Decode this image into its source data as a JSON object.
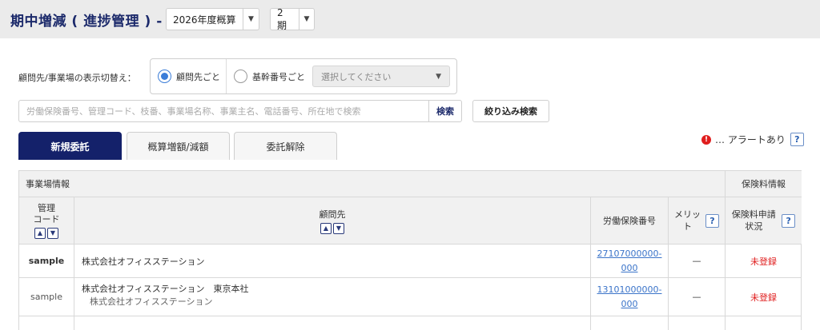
{
  "header": {
    "title": "期中増減 ( 進捗管理 ) -",
    "fiscal_select": "2026年度概算",
    "period_select": "2期"
  },
  "display_switch": {
    "label": "顧問先/事業場の表示切替え：",
    "option_client": "顧問先ごと",
    "option_kikan": "基幹番号ごと",
    "kikan_placeholder": "選択してください"
  },
  "search": {
    "placeholder": "労働保険番号、管理コード、枝番、事業場名称、事業主名、電話番号、所在地で検索",
    "button": "検索",
    "filter_button": "絞り込み検索"
  },
  "tabs": [
    {
      "label": "新規委託",
      "active": true
    },
    {
      "label": "概算増額/減額",
      "active": false
    },
    {
      "label": "委託解除",
      "active": false
    }
  ],
  "alert_legend": {
    "icon": "!",
    "text": "… アラートあり",
    "help": "?"
  },
  "table": {
    "group_jigyojo": "事業場情報",
    "group_hokenryo": "保険料情報",
    "col_code_l1": "管理",
    "col_code_l2": "コード",
    "col_client": "顧問先",
    "col_number": "労働保険番号",
    "col_merit_l1": "メリッ",
    "col_merit_l2": "ト",
    "col_status_l1": "保険料申請",
    "col_status_l2": "状況",
    "rows": [
      {
        "code": "sample",
        "name": "株式会社オフィスステーション",
        "sub": "",
        "number_l1": "27107000000-",
        "number_l2": "000",
        "merit": "—",
        "status": "未登録"
      },
      {
        "code": "sample",
        "name": "株式会社オフィスステーション　東京本社",
        "sub": "株式会社オフィスステーション",
        "number_l1": "13101000000-",
        "number_l2": "000",
        "merit": "—",
        "status": "未登録"
      }
    ]
  },
  "colors": {
    "navy": "#14216a",
    "alert": "#e01e1e",
    "link": "#3b74c9"
  }
}
